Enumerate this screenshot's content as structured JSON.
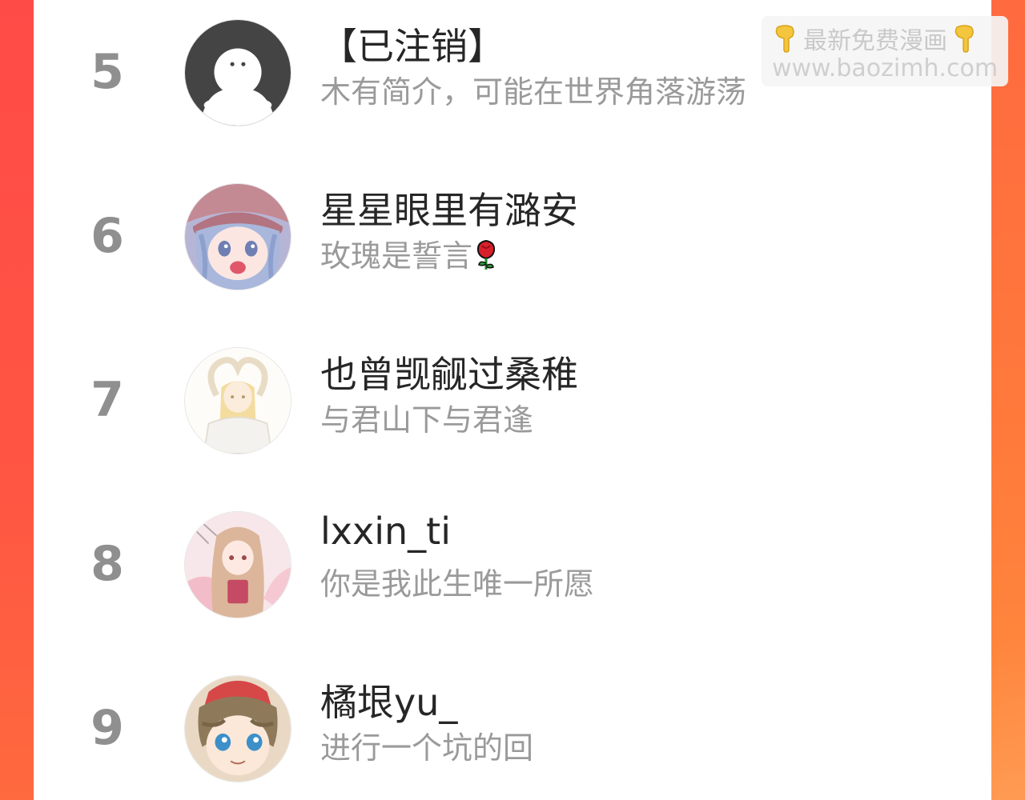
{
  "ranking": [
    {
      "rank": "5",
      "name": "【已注销】",
      "bio": "木有简介，可能在世界角落游荡",
      "avatar": "default-user-icon"
    },
    {
      "rank": "6",
      "name": "星星眼里有潞安",
      "bio": "玫瑰是誓言",
      "bio_emoji": "rose-icon",
      "avatar": "anime-girl-cap-avatar"
    },
    {
      "rank": "7",
      "name": "也曾觊觎过桑稚",
      "bio": "与君山下与君逢",
      "avatar": "anime-girl-heart-pose-avatar"
    },
    {
      "rank": "8",
      "name": "lxxin_ti",
      "bio": "你是我此生唯一所愿",
      "avatar": "anime-girl-pink-avatar"
    },
    {
      "rank": "9",
      "name": "橘垠yu_",
      "bio": "进行一个坑的回",
      "avatar": "anime-boy-avatar"
    }
  ],
  "watermark": {
    "line1": "最新免费漫画",
    "line2": "www.baozimh.com",
    "icon": "pointing-down-hand-icon"
  },
  "colors": {
    "background_left": "#ff4a45",
    "background_right": "#ff7a3a",
    "rank_number": "#8f8f8f",
    "name_text": "#262626",
    "bio_text": "#9a9a9a"
  }
}
